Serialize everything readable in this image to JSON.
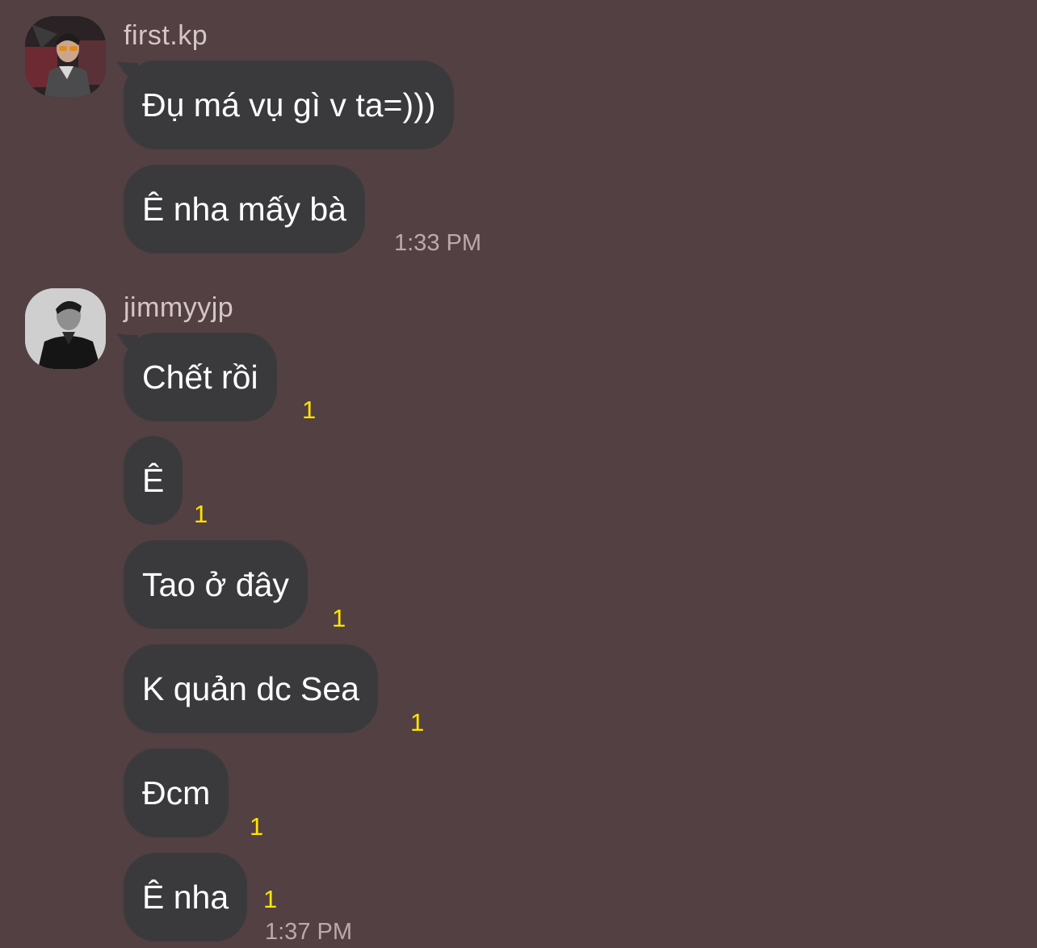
{
  "conversation": [
    {
      "sender": "first.kp",
      "avatar_icon": "user-avatar-photo",
      "messages": [
        {
          "text": "Đụ má vụ gì v ta=)))"
        },
        {
          "text": "Ê nha mấy bà",
          "time": "1:33 PM"
        }
      ]
    },
    {
      "sender": "jimmyyjp",
      "avatar_icon": "user-avatar-photo",
      "messages": [
        {
          "text": "Chết rồi",
          "unread": "1"
        },
        {
          "text": "Ê",
          "unread": "1"
        },
        {
          "text": "Tao ở đây",
          "unread": "1"
        },
        {
          "text": "K quản dc Sea",
          "unread": "1"
        },
        {
          "text": "Đcm",
          "unread": "1"
        },
        {
          "text": "Ê nha",
          "unread": "1",
          "time": "1:37 PM"
        }
      ]
    }
  ],
  "colors": {
    "background": "#534042",
    "bubble": "#3a3a3d",
    "unread": "#ffe400",
    "timestamp": "#b9aaac",
    "sender": "#d4c6c7"
  }
}
